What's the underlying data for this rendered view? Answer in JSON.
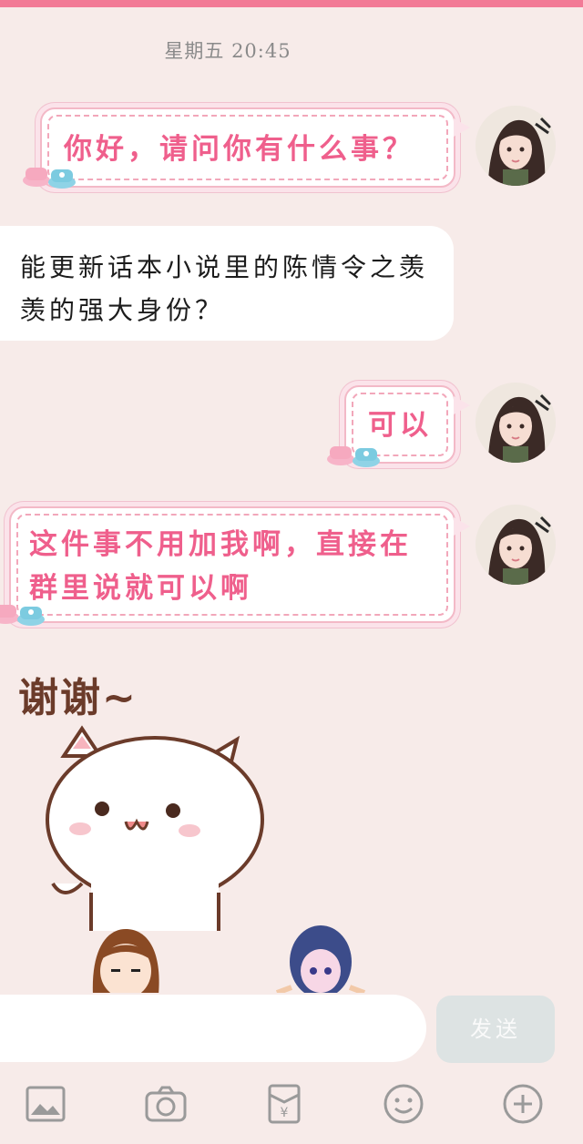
{
  "header": {
    "timestamp": "星期五 20:45"
  },
  "messages": [
    {
      "side": "right",
      "text": "你好，请问你有什么事？",
      "avatar": "girl-avatar"
    },
    {
      "side": "left",
      "text": "能更新话本小说里的陈情令之羡羡的强大身份？"
    },
    {
      "side": "right",
      "text": "可以",
      "avatar": "girl-avatar"
    },
    {
      "side": "right",
      "text_line1": "这件事不用加我啊，直接在",
      "text_line2": "群里说就可以啊",
      "avatar": "girl-avatar"
    }
  ],
  "sticker": {
    "caption": "谢谢~",
    "description_icon": "white-cat-sticker"
  },
  "composer": {
    "send_label": "发送",
    "input_value": ""
  },
  "toolbar": {
    "icons": [
      "image-icon",
      "camera-icon",
      "red-packet-icon",
      "emoji-icon",
      "plus-icon"
    ]
  },
  "colors": {
    "accent": "#f27a96",
    "bubble_text": "#ef5f8c",
    "background": "#f7ebe9"
  }
}
